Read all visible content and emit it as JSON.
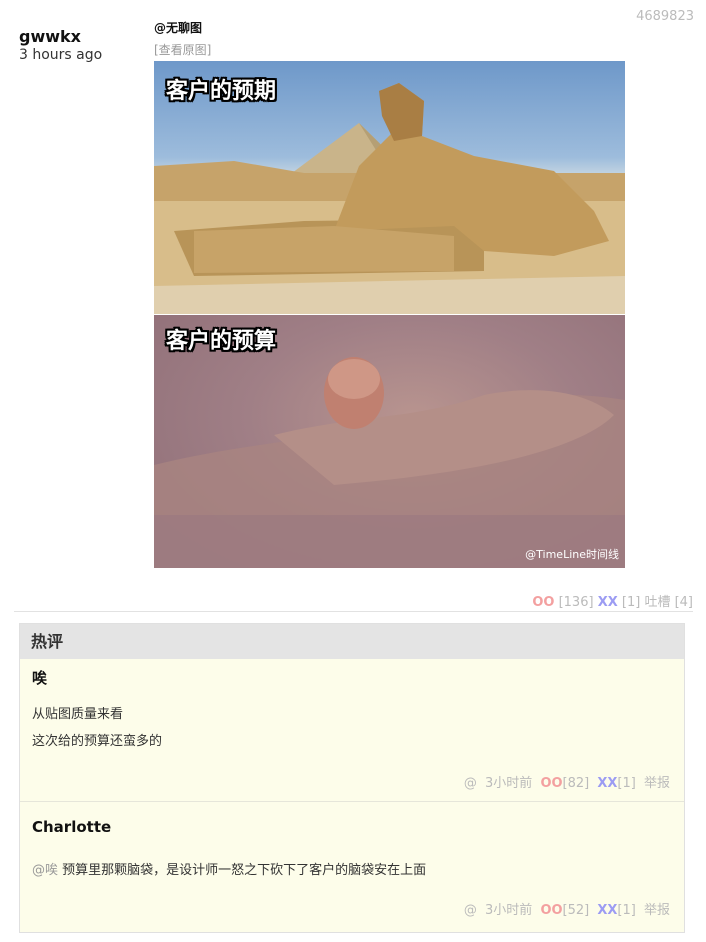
{
  "post": {
    "id": "4689823",
    "author": "gwwkx",
    "time": "3 hours ago",
    "mention": "@无聊图",
    "view_original": "[查看原图]",
    "meme": {
      "top_caption": "客户的预期",
      "bottom_caption": "客户的预算",
      "watermark": "@TimeLine时间线"
    },
    "votes": {
      "oo_label": "OO",
      "oo_count": "[136]",
      "xx_label": "XX",
      "xx_count": "[1]",
      "tucao": "吐槽 [4]"
    }
  },
  "hot_comments": {
    "header": "热评",
    "comments": [
      {
        "author": "唉",
        "lines": [
          "从贴图质量来看",
          "这次给的预算还蛮多的"
        ],
        "reply_to": "",
        "meta": {
          "at": "@",
          "time": "3小时前",
          "oo": "OO",
          "oo_count": "[82]",
          "xx": "XX",
          "xx_count": "[1]",
          "report": "举报"
        }
      },
      {
        "author": "Charlotte",
        "reply_to": "@唉",
        "text": "预算里那颗脑袋，是设计师一怒之下砍下了客户的脑袋安在上面",
        "meta": {
          "at": "@",
          "time": "3小时前",
          "oo": "OO",
          "oo_count": "[52]",
          "xx": "XX",
          "xx_count": "[1]",
          "report": "举报"
        }
      }
    ]
  },
  "colors": {
    "oo": "#f3a0a0",
    "xx": "#9c9cf3",
    "hot_bg": "#fdfdea",
    "hot_header_bg": "#e4e4e4"
  }
}
